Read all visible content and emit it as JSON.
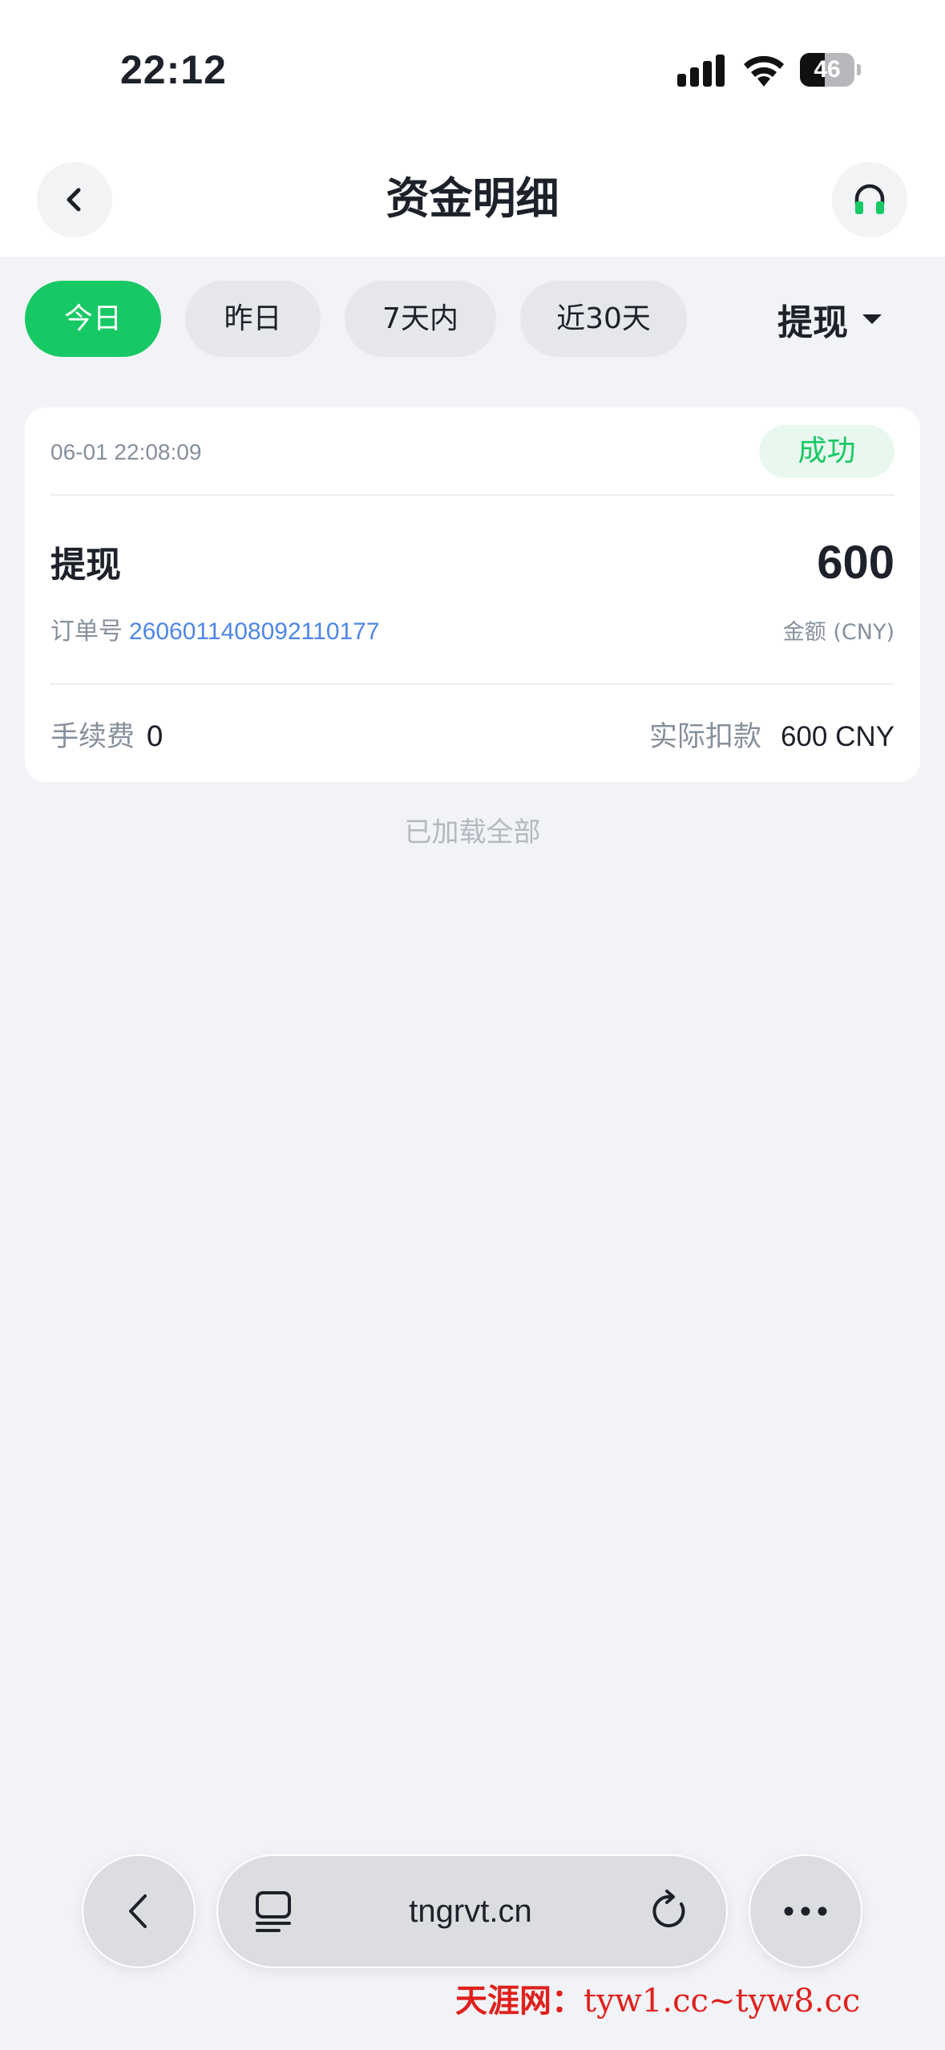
{
  "status_bar": {
    "time": "22:12",
    "battery": "46",
    "battery_level": 0.46
  },
  "header": {
    "title": "资金明细",
    "back_icon": "chevron-left-icon",
    "support_icon": "headset-icon"
  },
  "filters": {
    "chips": [
      {
        "label": "今日",
        "active": true
      },
      {
        "label": "昨日",
        "active": false
      },
      {
        "label": "7天内",
        "active": false
      },
      {
        "label": "近30天",
        "active": false
      }
    ],
    "type_dropdown": "提现"
  },
  "record": {
    "time": "06-01 22:08:09",
    "status": "成功",
    "type": "提现",
    "amount": "600",
    "order_label": "订单号",
    "order_no": "2606011408092110177",
    "amount_label": "金额 (CNY)",
    "fee_label": "手续费",
    "fee_value": "0",
    "deduct_label": "实际扣款",
    "deduct_value": "600 CNY"
  },
  "list_footer": "已加载全部",
  "browser": {
    "url": "tngrvt.cn"
  },
  "watermark": {
    "cn": "天涯网：",
    "en": "tyw1.cc~tyw8.cc"
  },
  "colors": {
    "accent": "#17c964",
    "link": "#4e86e8",
    "background": "#f2f3f7"
  }
}
